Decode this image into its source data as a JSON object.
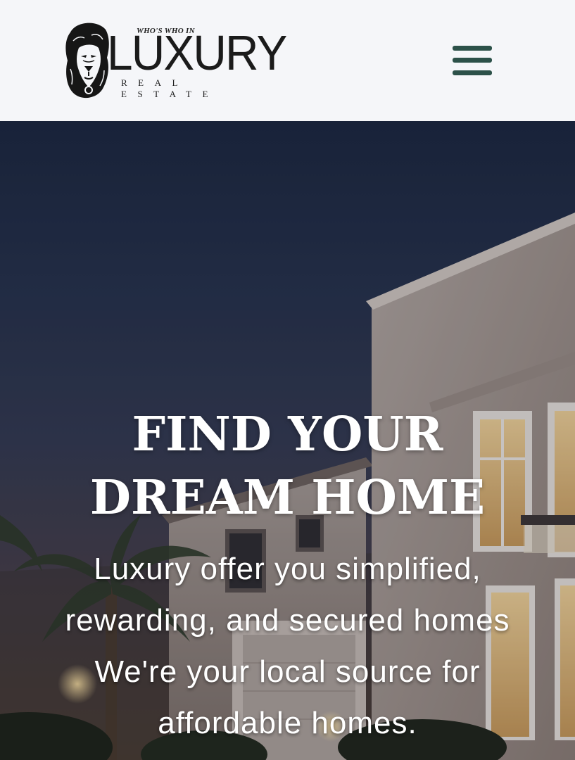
{
  "header": {
    "logo": {
      "kicker": "WHO'S WHO IN",
      "wordmark": "LUXURY",
      "tagline": "REAL ESTATE",
      "icon": "lion-head-icon"
    },
    "menu": {
      "icon": "hamburger-menu-icon",
      "color": "#2c5149"
    }
  },
  "hero": {
    "title_lines": [
      "FIND YOUR",
      "DREAM HOME"
    ],
    "text_lines": [
      "Luxury offer you simplified,",
      "rewarding, and secured homes",
      "We're your local source for",
      "affordable homes."
    ],
    "background": "luxury-house-at-dusk-image"
  },
  "colors": {
    "header_bg": "#f5f6f9",
    "accent": "#2c5149",
    "hero_text": "#ffffff",
    "logo_text": "#1b1b1b"
  }
}
